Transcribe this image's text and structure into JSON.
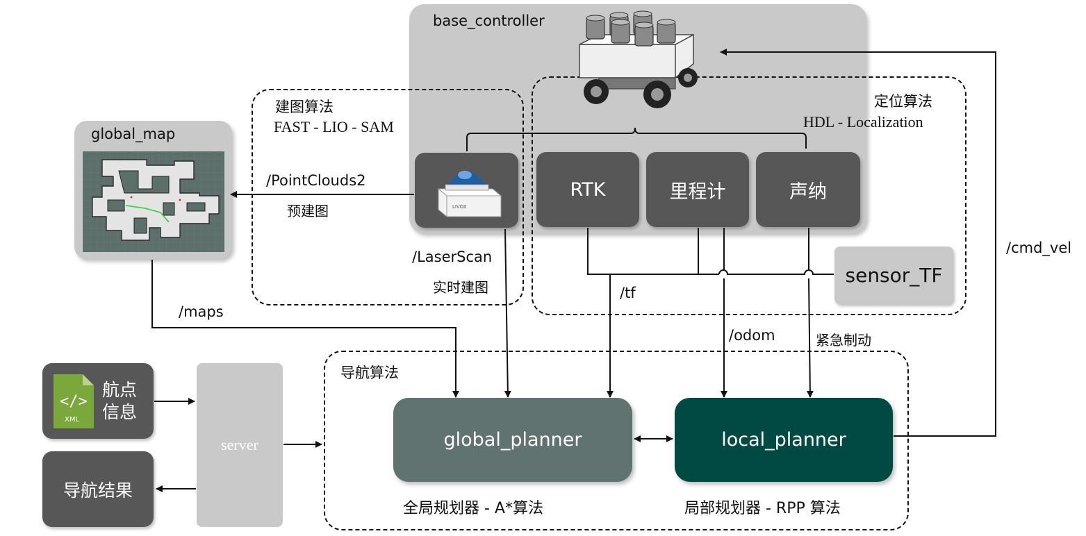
{
  "base_controller": {
    "title": "base_controller"
  },
  "mapping": {
    "title": "建图算法",
    "algorithm": "FAST - LIO - SAM"
  },
  "localization": {
    "title": "定位算法",
    "algorithm": "HDL - Localization"
  },
  "navigation": {
    "title": "导航算法"
  },
  "global_map": {
    "title": "global_map"
  },
  "lidar": {
    "brand": "LIVOX"
  },
  "sensors": {
    "rtk": "RTK",
    "odometer": "里程计",
    "sonar": "声纳",
    "sensor_tf": "sensor_TF"
  },
  "topics": {
    "pointclouds": "/PointClouds2",
    "pre_map": "预建图",
    "laserscan": "/LaserScan",
    "realtime_map": "实时建图",
    "maps": "/maps",
    "tf": "/tf",
    "odom": "/odom",
    "emergency_brake": "紧急制动",
    "cmd_vel": "/cmd_vel"
  },
  "planners": {
    "global": "global_planner",
    "global_caption": "全局规划器 - A*算法",
    "local": "local_planner",
    "local_caption": "局部规划器 - RPP 算法"
  },
  "server": {
    "label": "server"
  },
  "waypoint": {
    "label_line1": "航点",
    "label_line2": "信息",
    "file_type": "XML"
  },
  "result": {
    "label": "导航结果"
  },
  "colors": {
    "global_planner": "#607370",
    "local_planner": "#004a43",
    "panel": "#c9c9c9",
    "dark_box": "#575757",
    "xml_icon": "#7aa83a"
  }
}
